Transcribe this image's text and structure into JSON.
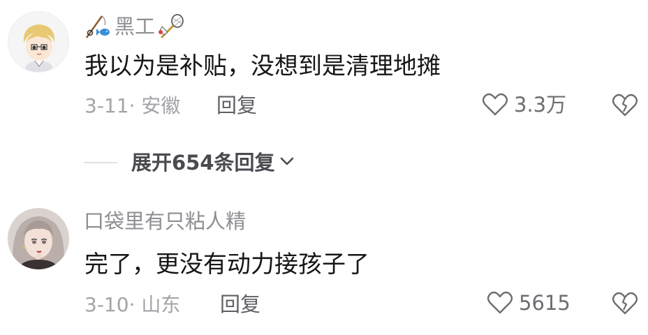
{
  "comments": [
    {
      "username": "黑工",
      "username_emoji_left": "fishing-pole-fish-icon",
      "username_emoji_right": "badminton-icon",
      "content": "我以为是补贴，没想到是清理地摊",
      "date_location": "3-11· 安徽",
      "reply_label": "回复",
      "likes": "3.3万",
      "avatar": "cartoon-boy-avatar"
    },
    {
      "username": "口袋里有只粘人精",
      "content": "完了，更没有动力接孩子了",
      "date_location": "3-10· 山东",
      "reply_label": "回复",
      "likes": "5615",
      "avatar": "anime-girl-avatar"
    }
  ],
  "expand_replies": {
    "label": "展开654条回复"
  },
  "colors": {
    "username": "#8e8e93",
    "content": "#161616",
    "meta": "#a3a3a8",
    "reply": "#5e5e63"
  }
}
